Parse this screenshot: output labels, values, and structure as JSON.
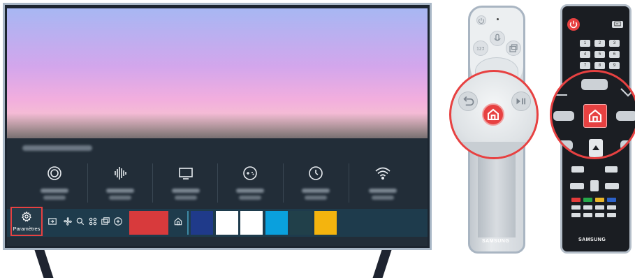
{
  "tv": {
    "settings_label": "Paramètres",
    "quick_settings": [
      "picture-mode-icon",
      "sound-icon",
      "display-icon",
      "game-mode-icon",
      "timer-icon",
      "wifi-icon"
    ],
    "bar_icons": [
      "source-icon",
      "ambient-icon",
      "search-icon",
      "apps-icon",
      "multiview-icon",
      "tv-plus-icon",
      "home-icon"
    ],
    "app_tile_colors": [
      "#d83a3c",
      "#1f3a8a",
      "#ffffff",
      "#ffffff",
      "#0aa0dd",
      "#21404a",
      "#f4b40e"
    ]
  },
  "remote_1": {
    "brand": "SAMSUNG",
    "highlight": "home-button"
  },
  "remote_2": {
    "brand": "SAMSUNG",
    "number_keys": [
      "1",
      "2",
      "3",
      "4",
      "5",
      "6",
      "7",
      "8",
      "9"
    ],
    "highlight": "home-button"
  },
  "colors": {
    "highlight": "#e74141"
  }
}
